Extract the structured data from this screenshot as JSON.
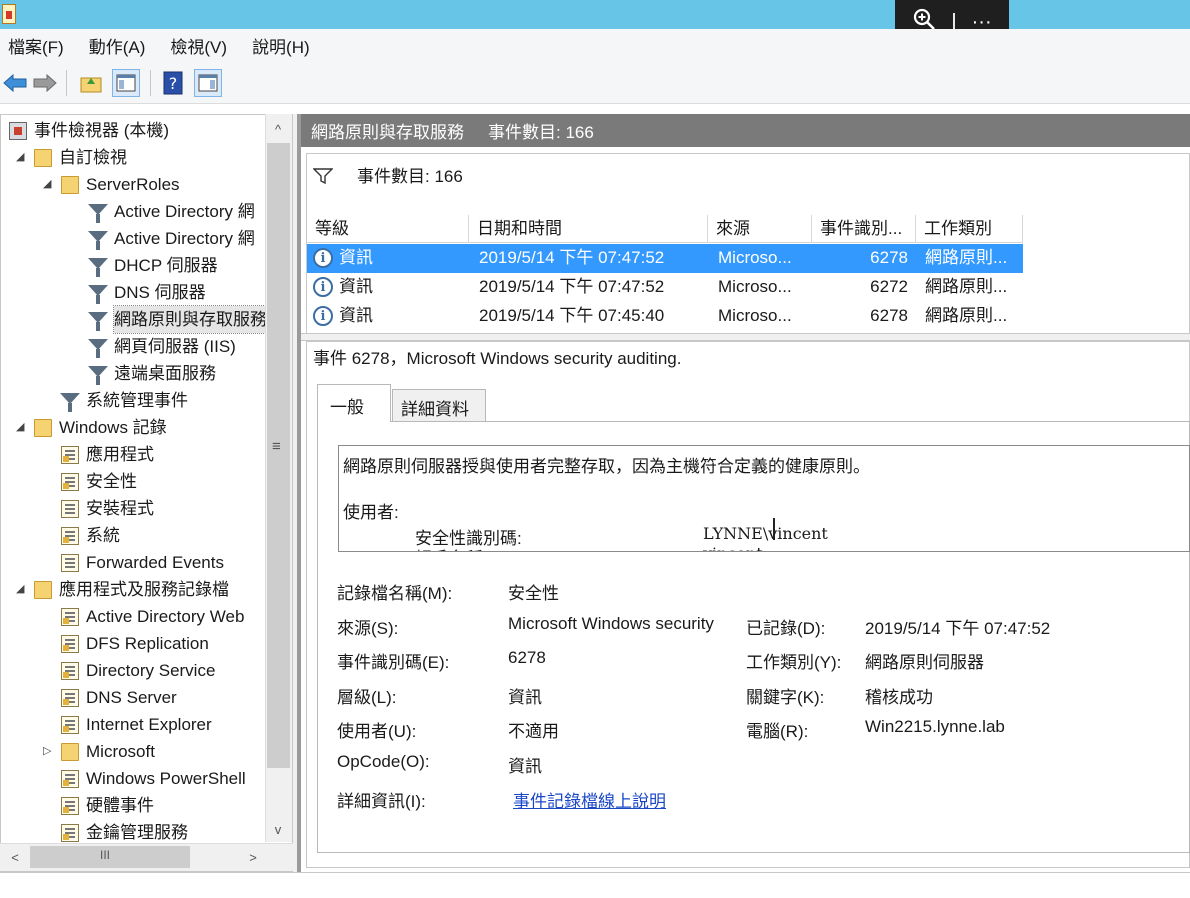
{
  "menu": {
    "file": "檔案(F)",
    "action": "動作(A)",
    "view": "檢視(V)",
    "help": "說明(H)"
  },
  "viewer_toolbar": {
    "zoom_icon": "zoom-in-icon",
    "more": "···"
  },
  "tree": [
    {
      "label": "事件檢視器 (本機)",
      "icon": "root",
      "indent": 0,
      "exp": ""
    },
    {
      "label": "自訂檢視",
      "icon": "folder",
      "indent": 1,
      "exp": "◢"
    },
    {
      "label": "ServerRoles",
      "icon": "folder",
      "indent": 2,
      "exp": "◢"
    },
    {
      "label": "Active Directory 網",
      "icon": "filter",
      "indent": 3,
      "exp": ""
    },
    {
      "label": "Active Directory 網",
      "icon": "filter",
      "indent": 3,
      "exp": ""
    },
    {
      "label": "DHCP 伺服器",
      "icon": "filter",
      "indent": 3,
      "exp": ""
    },
    {
      "label": "DNS 伺服器",
      "icon": "filter",
      "indent": 3,
      "exp": ""
    },
    {
      "label": "網路原則與存取服務",
      "icon": "filter",
      "indent": 3,
      "exp": "",
      "selected": true
    },
    {
      "label": "網頁伺服器 (IIS)",
      "icon": "filter",
      "indent": 3,
      "exp": ""
    },
    {
      "label": "遠端桌面服務",
      "icon": "filter",
      "indent": 3,
      "exp": ""
    },
    {
      "label": "系統管理事件",
      "icon": "filter",
      "indent": 2,
      "exp": ""
    },
    {
      "label": "Windows 記錄",
      "icon": "folder",
      "indent": 1,
      "exp": "◢"
    },
    {
      "label": "應用程式",
      "icon": "log-warn",
      "indent": 2,
      "exp": ""
    },
    {
      "label": "安全性",
      "icon": "log-warn",
      "indent": 2,
      "exp": ""
    },
    {
      "label": "安裝程式",
      "icon": "log",
      "indent": 2,
      "exp": ""
    },
    {
      "label": "系統",
      "icon": "log-warn",
      "indent": 2,
      "exp": ""
    },
    {
      "label": "Forwarded Events",
      "icon": "log",
      "indent": 2,
      "exp": ""
    },
    {
      "label": "應用程式及服務記錄檔",
      "icon": "folder",
      "indent": 1,
      "exp": "◢"
    },
    {
      "label": "Active Directory Web",
      "icon": "log-warn",
      "indent": 2,
      "exp": ""
    },
    {
      "label": "DFS Replication",
      "icon": "log-warn",
      "indent": 2,
      "exp": ""
    },
    {
      "label": "Directory Service",
      "icon": "log-warn",
      "indent": 2,
      "exp": ""
    },
    {
      "label": "DNS Server",
      "icon": "log-warn",
      "indent": 2,
      "exp": ""
    },
    {
      "label": "Internet Explorer",
      "icon": "log-warn",
      "indent": 2,
      "exp": ""
    },
    {
      "label": "Microsoft",
      "icon": "folder",
      "indent": 2,
      "exp": "▷"
    },
    {
      "label": "Windows PowerShell",
      "icon": "log-warn",
      "indent": 2,
      "exp": ""
    },
    {
      "label": "硬體事件",
      "icon": "log-warn",
      "indent": 2,
      "exp": ""
    },
    {
      "label": "金鑰管理服務",
      "icon": "log-warn",
      "indent": 2,
      "exp": ""
    }
  ],
  "scrollbar": {
    "up": "^",
    "down": "v",
    "grip": "≡",
    "left": "<",
    "right": ">",
    "hgrip": "III"
  },
  "right_header": {
    "title": "網路原則與存取服務",
    "count": "事件數目: 166"
  },
  "filter_bar": {
    "text": "事件數目: 166"
  },
  "grid": {
    "headers": [
      "等級",
      "日期和時間",
      "來源",
      "事件識別...",
      "工作類別"
    ],
    "rows": [
      {
        "level": "資訊",
        "datetime": "2019/5/14 下午 07:47:52",
        "source": "Microso...",
        "id": "6278",
        "category": "網路原則...",
        "selected": true
      },
      {
        "level": "資訊",
        "datetime": "2019/5/14 下午 07:47:52",
        "source": "Microso...",
        "id": "6272",
        "category": "網路原則..."
      },
      {
        "level": "資訊",
        "datetime": "2019/5/14 下午 07:45:40",
        "source": "Microso...",
        "id": "6278",
        "category": "網路原則..."
      }
    ]
  },
  "detail": {
    "title": "事件 6278，Microsoft Windows security auditing.",
    "tab_general": "一般",
    "tab_details": "詳細資料",
    "desc_line1": "網路原則伺服器授與使用者完整存取，因為主機符合定義的健康原則。",
    "desc_user": "使用者:",
    "desc_sid_label": "安全性識別碼:",
    "desc_sid_value": "LYNNE\\vincent",
    "desc_cut_label": "帳戶名稱:",
    "desc_cut_value": "vincent",
    "fields": {
      "log_name_label": "記錄檔名稱(M):",
      "log_name_value": "安全性",
      "source_label": "來源(S):",
      "source_value": "Microsoft Windows security",
      "logged_label": "已記錄(D):",
      "logged_value": "2019/5/14 下午 07:47:52",
      "event_id_label": "事件識別碼(E):",
      "event_id_value": "6278",
      "task_label": "工作類別(Y):",
      "task_value": "網路原則伺服器",
      "level_label": "層級(L):",
      "level_value": "資訊",
      "keywords_label": "關鍵字(K):",
      "keywords_value": "稽核成功",
      "user_label": "使用者(U):",
      "user_value": "不適用",
      "computer_label": "電腦(R):",
      "computer_value": "Win2215.lynne.lab",
      "opcode_label": "OpCode(O):",
      "opcode_value": "資訊",
      "more_label": "詳細資訊(I):",
      "more_link": "事件記錄檔線上說明"
    }
  },
  "colors": {
    "titlebar": "#67c6e8",
    "selection": "#3399ff",
    "header": "#7a7a7a",
    "link": "#1a47c8"
  }
}
